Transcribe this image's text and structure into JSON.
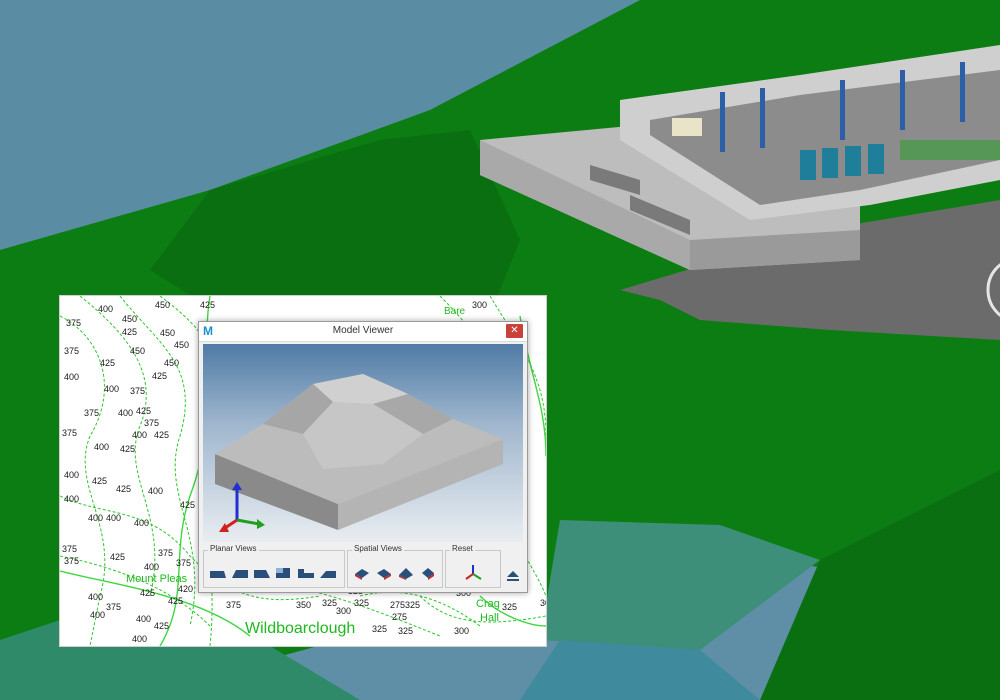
{
  "window": {
    "title": "Model Viewer",
    "logo": "M",
    "close_icon": "close-icon"
  },
  "toolbar": {
    "planar_label": "Planar Views",
    "spatial_label": "Spatial Views",
    "reset_label": "Reset",
    "planar_buttons": [
      "planar-view-front-icon",
      "planar-view-back-icon",
      "planar-view-left-icon",
      "planar-view-right-icon",
      "planar-view-top-icon",
      "planar-view-bottom-icon"
    ],
    "spatial_buttons": [
      "iso-view-1-icon",
      "iso-view-2-icon",
      "iso-view-3-icon",
      "iso-view-4-icon"
    ],
    "reset_button": "axes-reset-icon",
    "eject_button": "eject-icon"
  },
  "map": {
    "place_names": [
      "Mount Pleas",
      "Wildboarclough",
      "Crag",
      "Hall",
      "Bare"
    ],
    "contours": [
      "450",
      "400",
      "450",
      "425",
      "450",
      "450",
      "450",
      "425",
      "300",
      "375",
      "425",
      "375",
      "400",
      "450",
      "425",
      "400",
      "375",
      "375",
      "400",
      "425",
      "375",
      "400",
      "425",
      "425",
      "400",
      "375",
      "400",
      "425",
      "425",
      "400",
      "400",
      "400",
      "400",
      "400",
      "425",
      "375",
      "425",
      "375",
      "375",
      "400",
      "375",
      "425",
      "400",
      "375",
      "425",
      "400",
      "420",
      "400",
      "425",
      "400",
      "375",
      "350",
      "325",
      "300",
      "325",
      "275325",
      "275",
      "325",
      "325",
      "300",
      "325",
      "300",
      "325",
      "300",
      "325"
    ]
  },
  "colors": {
    "terrain_green": "#0b7d12",
    "sky_blue": "#5e8fa6",
    "contour_green": "#1fb81f",
    "close_red": "#c9423a"
  }
}
